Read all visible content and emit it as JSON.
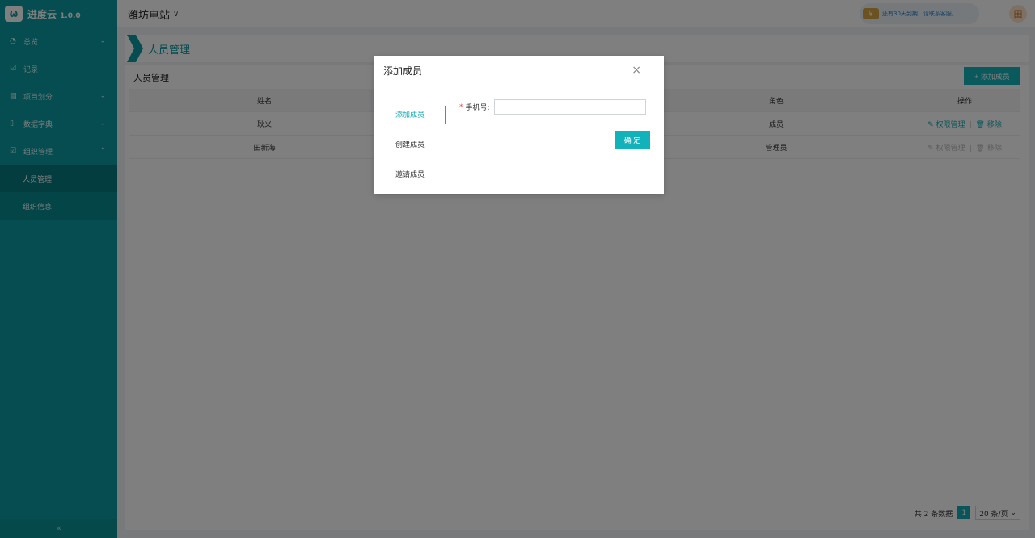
{
  "app": {
    "name": "进度云",
    "version": "1.0.0"
  },
  "sidebar": {
    "items": [
      {
        "label": "总览",
        "icon": "◔",
        "has_children": true
      },
      {
        "label": "记录",
        "icon": "☑",
        "has_children": false
      },
      {
        "label": "项目划分",
        "icon": "▤",
        "has_children": true
      },
      {
        "label": "数据字典",
        "icon": "▯",
        "has_children": true
      },
      {
        "label": "组织管理",
        "icon": "☑",
        "has_children": true,
        "expanded": true
      }
    ],
    "submenu": [
      {
        "label": "人员管理",
        "active": true
      },
      {
        "label": "组织信息",
        "active": false
      }
    ],
    "collapse_label": "«"
  },
  "topbar": {
    "site": "潍坊电站",
    "notice_text": "还有30天到期，请联系客服。",
    "avatar_text": "田"
  },
  "page": {
    "header_title": "人员管理",
    "panel_title": "人员管理",
    "add_button": "+ 添加成员"
  },
  "table": {
    "columns": [
      "姓名",
      "",
      "角色",
      "操作"
    ],
    "rows": [
      {
        "name": "耿义",
        "role": "成员",
        "enabled": true
      },
      {
        "name": "田新海",
        "role": "管理员",
        "enabled": false
      }
    ],
    "action_permission": "权限管理",
    "action_remove": "移除"
  },
  "pager": {
    "total_text": "共 2 条数据",
    "current_page": "1",
    "page_size": "20 条/页"
  },
  "modal": {
    "title": "添加成员",
    "close": "×",
    "tabs": [
      "添加成员",
      "创建成员",
      "邀请成员"
    ],
    "active_tab": 0,
    "field_label": "手机号:",
    "field_value": "",
    "confirm_button": "确 定"
  },
  "colors": {
    "sidebar": "#0b9aa0",
    "accent": "#12b2ba",
    "danger": "#e84a4a"
  }
}
